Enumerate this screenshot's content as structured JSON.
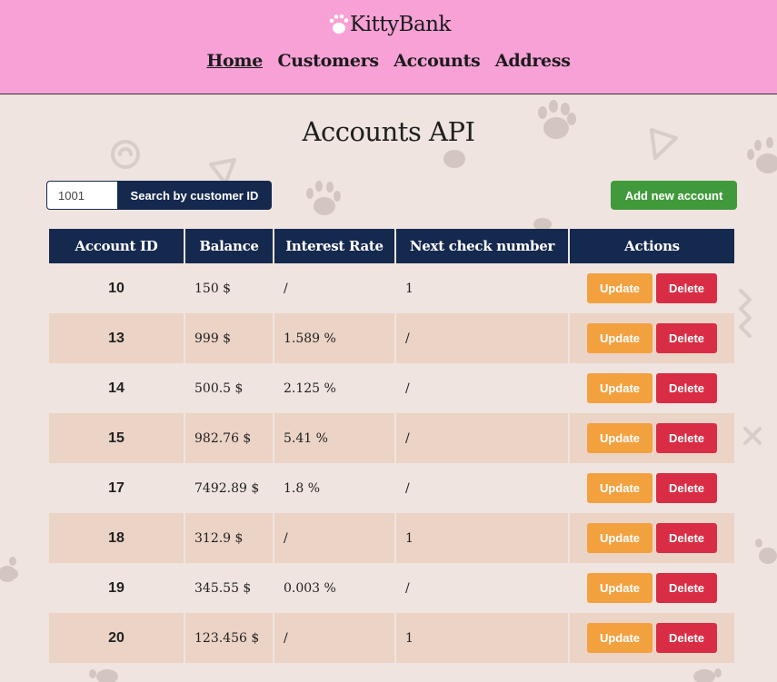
{
  "brand": {
    "name": "KittyBank"
  },
  "nav": [
    {
      "label": "Home",
      "active": true
    },
    {
      "label": "Customers",
      "active": false
    },
    {
      "label": "Accounts",
      "active": false
    },
    {
      "label": "Address",
      "active": false
    }
  ],
  "page_title": "Accounts API",
  "search": {
    "value": "1001",
    "button_label": "Search by customer ID"
  },
  "add_button_label": "Add new account",
  "table": {
    "headers": [
      "Account ID",
      "Balance",
      "Interest Rate",
      "Next check number",
      "Actions"
    ],
    "rows": [
      {
        "id": "10",
        "balance": "150 $",
        "interest": "/",
        "check": "1"
      },
      {
        "id": "13",
        "balance": "999 $",
        "interest": "1.589 %",
        "check": "/"
      },
      {
        "id": "14",
        "balance": "500.5 $",
        "interest": "2.125 %",
        "check": "/"
      },
      {
        "id": "15",
        "balance": "982.76 $",
        "interest": "5.41 %",
        "check": "/"
      },
      {
        "id": "17",
        "balance": "7492.89 $",
        "interest": "1.8 %",
        "check": "/"
      },
      {
        "id": "18",
        "balance": "312.9 $",
        "interest": "/",
        "check": "1"
      },
      {
        "id": "19",
        "balance": "345.55 $",
        "interest": "0.003 %",
        "check": "/"
      },
      {
        "id": "20",
        "balance": "123.456 $",
        "interest": "/",
        "check": "1"
      }
    ],
    "update_label": "Update",
    "delete_label": "Delete"
  },
  "colors": {
    "header_bg": "#f7a1d6",
    "page_bg": "#efe4df",
    "navy": "#15294f",
    "green": "#409a3c",
    "orange": "#f3a13f",
    "red": "#d92d45",
    "row_alt": "#ebd3c6"
  }
}
